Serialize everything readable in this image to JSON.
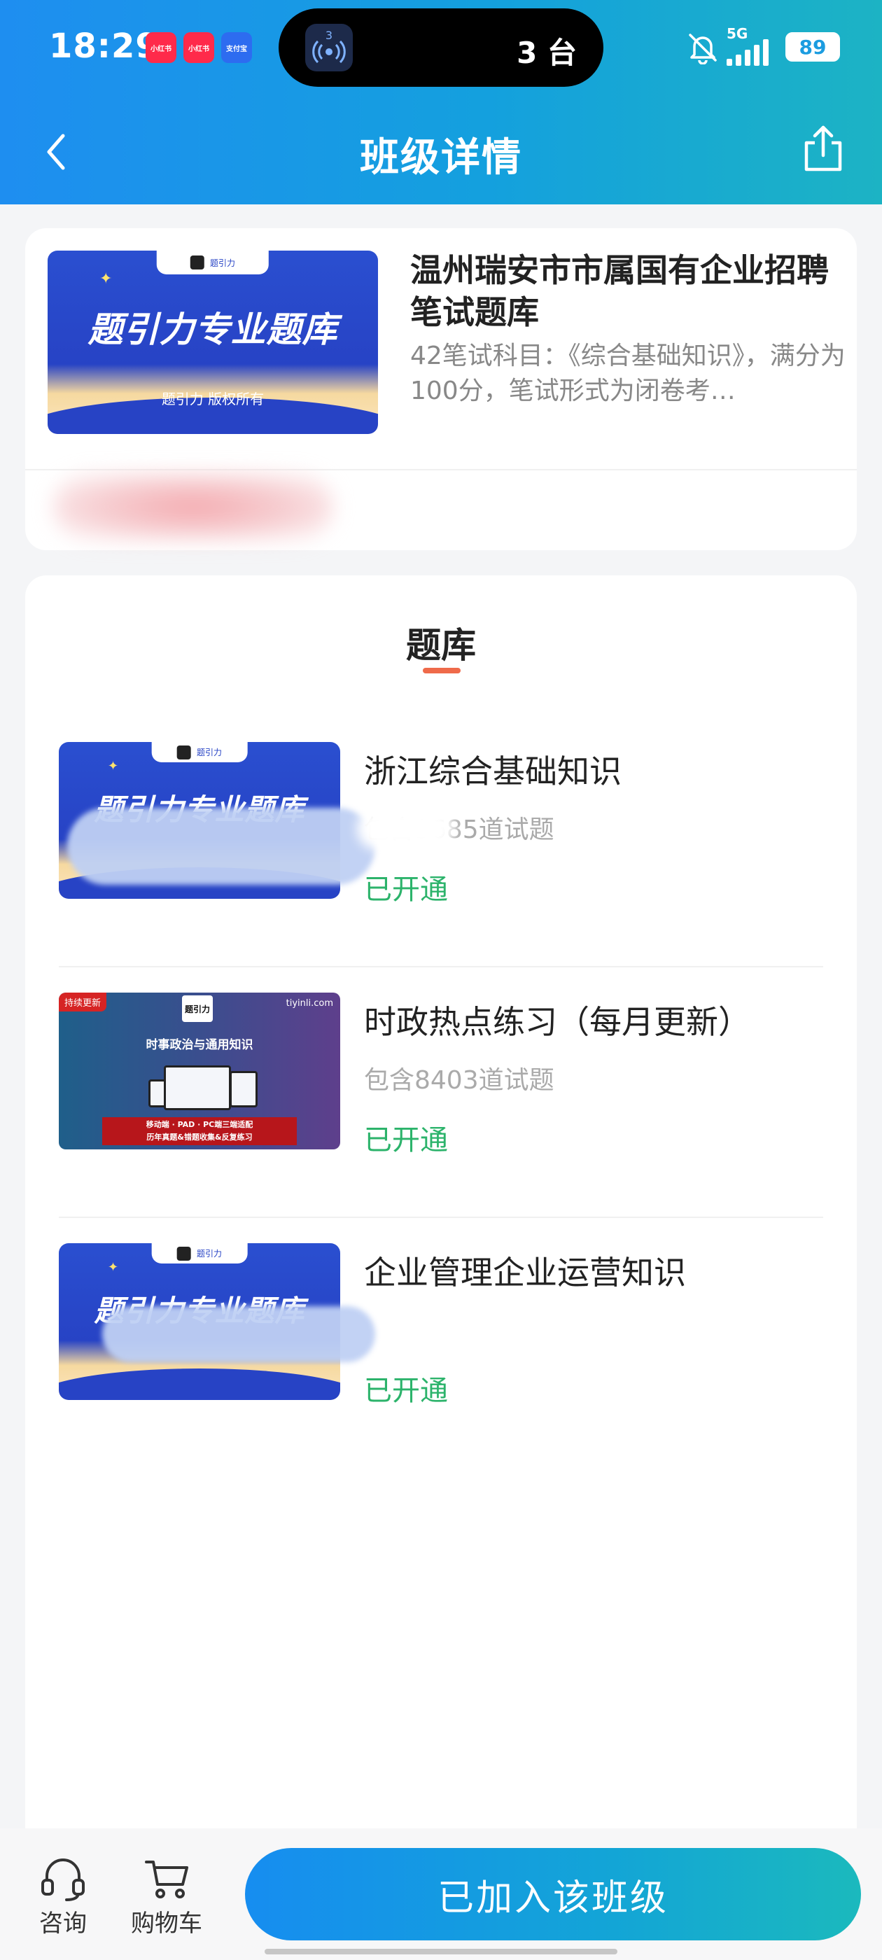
{
  "status_bar": {
    "time": "18:29",
    "app_badges": [
      "小红书",
      "小红书",
      "支付宝"
    ],
    "island_count": "3",
    "island_text": "3 台",
    "network": "5G",
    "battery": "89"
  },
  "nav": {
    "title": "班级详情",
    "back_icon": "chevron-left-icon",
    "share_icon": "share-icon"
  },
  "class_info": {
    "title": "温州瑞安市市属国有企业招聘笔试题库",
    "description": "42笔试科目：《综合基础知识》，满分为100分，笔试形式为闭卷考…",
    "cover": {
      "tab": "题引力",
      "heading": "题引力专业题库",
      "footer": "题引力 版权所有"
    }
  },
  "question_bank": {
    "section_title": "题库",
    "items": [
      {
        "title": "浙江综合基础知识",
        "count": "包含3685道试题",
        "status": "已开通",
        "cover_tab": "题引力",
        "cover_heading": "题引力专业题库"
      },
      {
        "title": "时政热点练习（每月更新）",
        "count": "包含8403道试题",
        "status": "已开通",
        "cover_tag": "持续更新",
        "cover_logo": "题引力",
        "cover_url": "tiyinli.com",
        "cover_heading": "时事政治与通用知识",
        "cover_banner_1": "移动端 · PAD · PC端三端适配",
        "cover_banner_2": "历年真题&错题收集&反复练习"
      },
      {
        "title": "企业管理企业运营知识",
        "count": "",
        "status": "已开通",
        "cover_tab": "题引力",
        "cover_heading": "题引力专业题库"
      }
    ]
  },
  "bottom_bar": {
    "consult_label": "咨询",
    "consult_icon": "headset-icon",
    "cart_label": "购物车",
    "cart_icon": "cart-icon",
    "join_button": "已加入该班级"
  },
  "colors": {
    "header_start": "#1e8ef0",
    "header_end": "#1cb3c4",
    "status_green": "#2cb36b",
    "underline": "#ef6a4a"
  }
}
